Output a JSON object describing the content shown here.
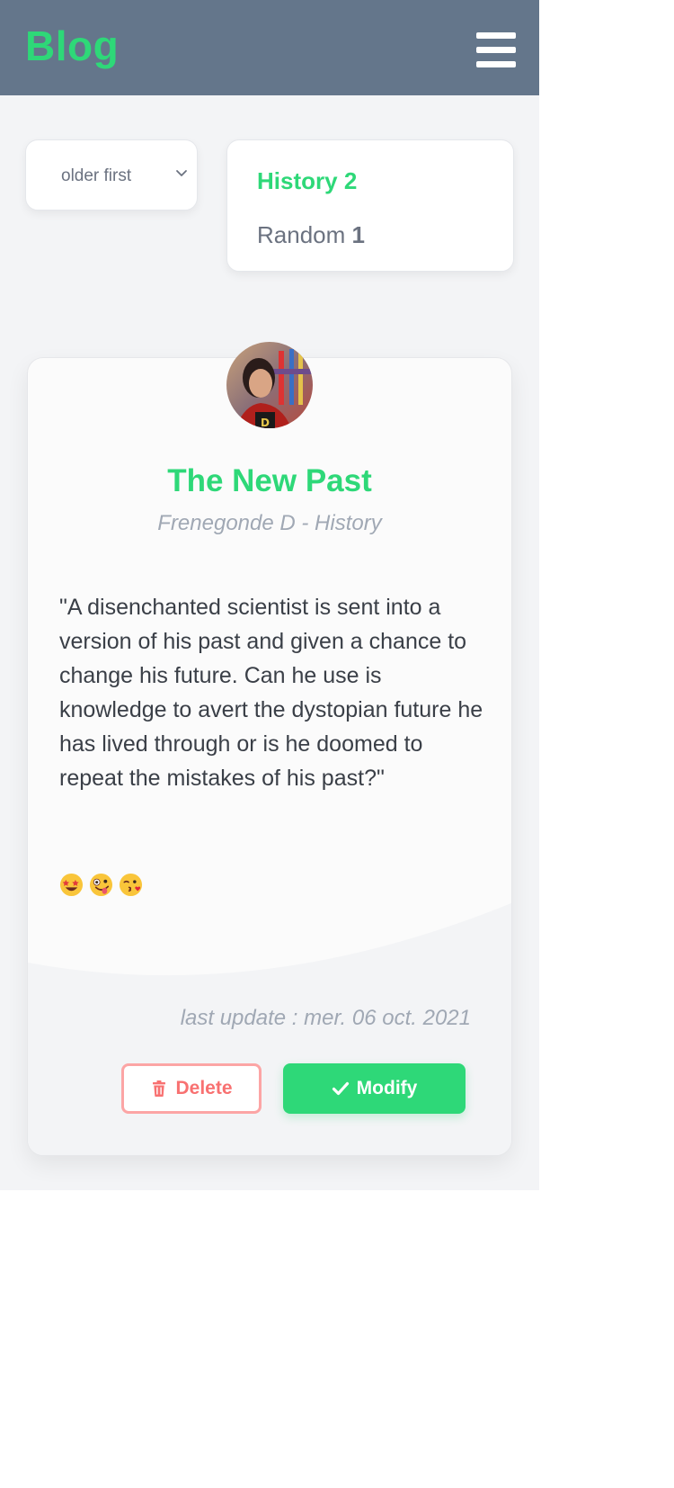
{
  "navbar": {
    "brand": "Blog",
    "menu_icon": "hamburger-menu-icon"
  },
  "sort": {
    "selected": "older first",
    "icon": "chevron-down-icon"
  },
  "categories": [
    {
      "name": "History",
      "count": "2",
      "active": true
    },
    {
      "name": "Random",
      "count": "1",
      "active": false
    }
  ],
  "post": {
    "title": "The New Past",
    "author_line": "Frenegonde D - History",
    "body": "\"A disenchanted scientist is sent into a version of his past and given a chance to change his future. Can he use is knowledge to avert the dystopian future he has lived through or is he doomed to repeat the mistakes of his past?\"",
    "emojis": [
      "star-struck-emoji",
      "zany-face-emoji",
      "face-blowing-kiss-emoji"
    ],
    "last_update": "last update : mer. 06 oct. 2021",
    "delete_label": "Delete",
    "modify_label": "Modify"
  },
  "colors": {
    "brand_green": "#2ed878",
    "navbar_bg": "#64768b",
    "danger": "#f87171"
  }
}
